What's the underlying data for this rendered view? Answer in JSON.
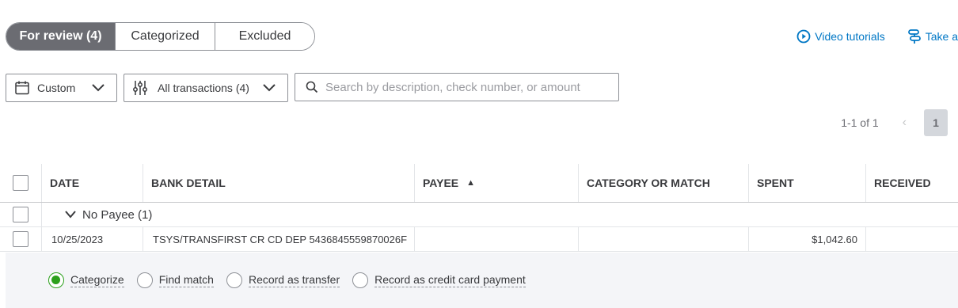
{
  "tabs": [
    {
      "label": "For review (4)"
    },
    {
      "label": "Categorized"
    },
    {
      "label": "Excluded"
    }
  ],
  "top_links": {
    "video_tutorials": "Video tutorials",
    "take_tour": "Take a"
  },
  "filters": {
    "date_label": "Custom",
    "transactions_label": "All transactions (4)",
    "search_placeholder": "Search by description, check number, or amount"
  },
  "pagination": {
    "range": "1-1 of 1",
    "prev": "‹",
    "current_page": "1"
  },
  "table": {
    "columns": [
      "DATE",
      "BANK DETAIL",
      "PAYEE",
      "CATEGORY OR MATCH",
      "SPENT",
      "RECEIVED"
    ],
    "sort_indicator": "▲",
    "group": {
      "label": "No Payee (1)"
    },
    "rows": [
      {
        "date": "10/25/2023",
        "bank_detail": "TSYS/TRANSFIRST CR CD DEP 5436845559870026F",
        "payee": "",
        "category": "",
        "spent": "$1,042.60",
        "received": ""
      }
    ]
  },
  "actions": {
    "options": [
      "Categorize",
      "Find match",
      "Record as transfer",
      "Record as credit card payment"
    ],
    "selected": "Categorize"
  },
  "colors": {
    "accent_link": "#0077c5",
    "active_tab": "#6b6c72",
    "selected_radio": "#2ca01c"
  }
}
